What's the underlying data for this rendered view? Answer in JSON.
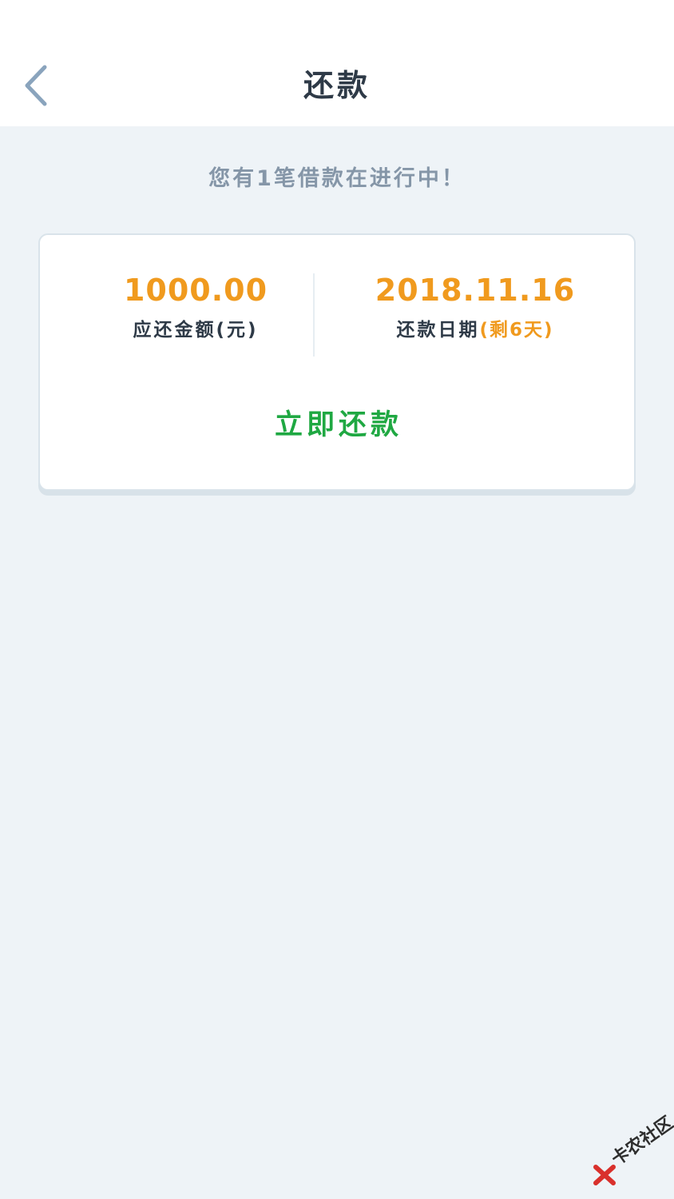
{
  "header": {
    "title": "还款",
    "back_icon": "chevron-left-icon"
  },
  "notice": "您有1笔借款在进行中！",
  "card": {
    "amount": {
      "value": "1000.00",
      "label": "应还金额(元)"
    },
    "due": {
      "value": "2018.11.16",
      "label": "还款日期",
      "remaining": "(剩6天)"
    },
    "pay_button": "立即还款"
  },
  "watermark": "卡农社区",
  "colors": {
    "accent_orange": "#f09a1e",
    "action_green": "#1fa842",
    "background": "#eef3f7",
    "title_text": "#2e3a47",
    "notice_text": "#8596a8",
    "back_icon": "#8aa4bd"
  }
}
